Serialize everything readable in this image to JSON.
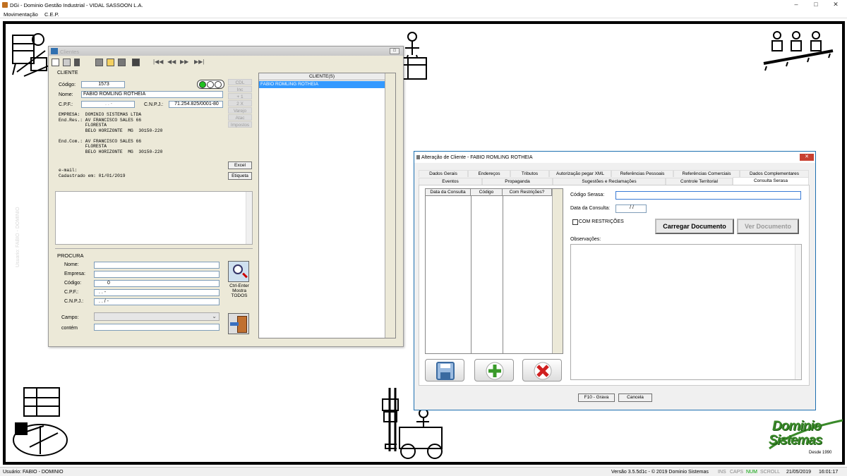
{
  "window": {
    "title": "DGi - Dominio Gestão Industrial - VIDAL SASSOON L.A."
  },
  "menu": [
    "Movimentação",
    "C.E.P."
  ],
  "watermark": "Usuario: FABIO - DOMINIO",
  "clientes": {
    "title": "Clientes",
    "section_label": "CLIENTE",
    "codigo_label": "Código:",
    "codigo_value": "1573",
    "nome_label": "Nome:",
    "nome_value": "FABIO ROMLING ROTHEIA",
    "cpf_label": "C.P.F.:",
    "cpf_value": ". . -",
    "cnpj_label": "C.N.P.J.:",
    "cnpj_value": "71.254.825/0001-80",
    "side_buttons": [
      "CDL",
      "Inc",
      "+ 1",
      "2 X",
      "Varejo",
      "Atac",
      "Impostos"
    ],
    "info_block": "EMPRESA:  DOMINIO SISTEMAS LTDA\nEnd.Res.: AV FRANCISCO SALES 66\n          FLORESTA\n          BELO HORIZONTE  MG  30150-220\n\nEnd.Com.: AV FRANCISCO SALES 66\n          FLORESTA\n          BELO HORIZONTE  MG  30150-220",
    "email_block": "e-mail:\nCadastrado em: 01/01/2019",
    "excel_label": "Excel",
    "etiqueta_label": "Etiqueta",
    "procura_label": "PROCURA",
    "search_fields": [
      {
        "label": "Nome:",
        "value": ""
      },
      {
        "label": "Empresa:",
        "value": ""
      },
      {
        "label": "Código:",
        "value": "0"
      },
      {
        "label": "C.P.F.:",
        "value": ". . -"
      },
      {
        "label": "C.N.P.J.:",
        "value": ". . / -"
      }
    ],
    "campo_label": "Campo:",
    "contem_label": "contém",
    "ctrl_enter_text": "Ctrl-Enter\nMostra\nTODOS",
    "list_header": "CLIENTE(S)",
    "list_items": [
      "FABIO ROMLING ROTHEIA"
    ]
  },
  "alteracao": {
    "title": "Alteração de Cliente - FABIO ROMLING ROTHEIA",
    "tabs_row1": [
      "Dados Gerais",
      "Endereços",
      "Tributos",
      "Autorização pegar XML",
      "Referências Pessoais",
      "Referências Comerciais",
      "Dados Complementares"
    ],
    "tabs_row2": [
      "Eventos",
      "Propaganda",
      "Sugestões e Reclamações",
      "Controle Territorial",
      "Consulta Serasa"
    ],
    "selected_tab": "Consulta Serasa",
    "grid_columns": [
      "Data da Consulta",
      "Código",
      "Com Restrições?"
    ],
    "codigo_serasa_label": "Código Serasa:",
    "codigo_serasa_value": "",
    "data_consulta_label": "Data da Consulta:",
    "data_consulta_value": "/ /",
    "com_restricoes_label": "COM RESTRIÇÕES",
    "carregar_label": "Carregar Documento",
    "ver_label": "Ver Documento",
    "observacoes_label": "Observações:",
    "grava_label": "F10 - Grava",
    "cancela_label": "Cancela"
  },
  "logo": {
    "line1": "Dominio",
    "line2": "Sistemas",
    "since": "Desde 1990"
  },
  "status": {
    "user": "Usuário: FABIO - DOMINIO",
    "version": "Versão 3.5.5d1c - © 2019 Dominio Sistemas",
    "ins": "INS",
    "caps": "CAPS",
    "num": "NUM",
    "scroll": "SCROLL",
    "date": "21/05/2019",
    "time": "16:01:17"
  },
  "colors": {
    "selection": "#3399ff",
    "num_green": "#00a000",
    "logo_green": "#3a8a2a"
  }
}
